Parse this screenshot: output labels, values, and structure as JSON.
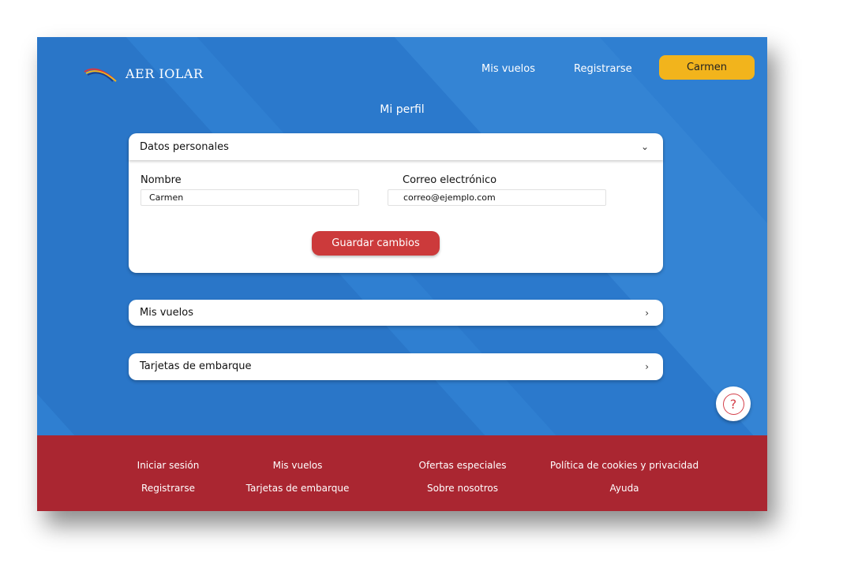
{
  "brand": {
    "name": "AER IOLAR",
    "colors": {
      "primary": "#2f7fd1",
      "accent": "#f2b41c",
      "footer": "#aa2631",
      "button": "#cc3a3b"
    }
  },
  "nav": {
    "flights": "Mis vuelos",
    "register": "Registrarse",
    "user": "Carmen"
  },
  "page": {
    "title": "Mi perfil"
  },
  "personal": {
    "header": "Datos personales",
    "name_label": "Nombre",
    "name_value": "Carmen",
    "email_label": "Correo electrónico",
    "email_value": "correo@ejemplo.com",
    "save": "Guardar cambios"
  },
  "sections": {
    "flights": "Mis vuelos",
    "boarding": "Tarjetas de embarque"
  },
  "help": {
    "icon": "question-icon",
    "glyph": "?"
  },
  "footer": {
    "col1": [
      "Iniciar sesión",
      "Registrarse"
    ],
    "col2": [
      "Mis vuelos",
      "Tarjetas de embarque"
    ],
    "col3": [
      "Ofertas especiales",
      "Sobre nosotros"
    ],
    "col4": [
      "Política de cookies y privacidad",
      "Ayuda"
    ]
  }
}
